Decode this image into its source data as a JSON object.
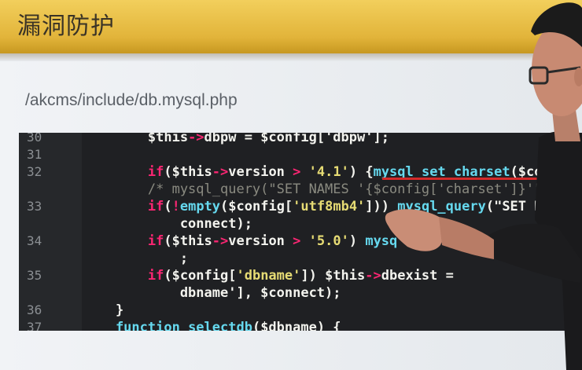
{
  "slide": {
    "title": "漏洞防护",
    "path": "/akcms/include/db.mysql.php"
  },
  "code": {
    "lines": [
      {
        "num": "30",
        "parts": [
          {
            "t": "        $this",
            "c": "pl"
          },
          {
            "t": "->",
            "c": "kw"
          },
          {
            "t": "dbpw = $config['dbpw'];",
            "c": "pl"
          }
        ]
      },
      {
        "num": "31",
        "parts": []
      },
      {
        "num": "32",
        "parts": [
          {
            "t": "        if",
            "c": "kw"
          },
          {
            "t": "($this",
            "c": "pl"
          },
          {
            "t": "->",
            "c": "kw"
          },
          {
            "t": "version ",
            "c": "pl"
          },
          {
            "t": ">",
            "c": "kw"
          },
          {
            "t": " ",
            "c": "pl"
          },
          {
            "t": "'4.1'",
            "c": "str"
          },
          {
            "t": ") {",
            "c": "pl"
          },
          {
            "t": "mysql_set_charset",
            "c": "fn"
          },
          {
            "t": "($confi",
            "c": "pl"
          }
        ]
      },
      {
        "num": "",
        "parts": [
          {
            "t": "        /* mysql_query(\"SET NAMES '{$config['charset']}'\", ",
            "c": "cmt"
          }
        ]
      },
      {
        "num": "33",
        "parts": [
          {
            "t": "        if",
            "c": "kw"
          },
          {
            "t": "(",
            "c": "pl"
          },
          {
            "t": "!",
            "c": "kw"
          },
          {
            "t": "empty",
            "c": "fn"
          },
          {
            "t": "($config[",
            "c": "pl"
          },
          {
            "t": "'utf8mb4'",
            "c": "str"
          },
          {
            "t": "])) ",
            "c": "pl"
          },
          {
            "t": "mysql_query",
            "c": "fn"
          },
          {
            "t": "(\"SET NAM",
            "c": "pl"
          }
        ]
      },
      {
        "num": "",
        "parts": [
          {
            "t": "            connect);",
            "c": "pl"
          }
        ]
      },
      {
        "num": "34",
        "parts": [
          {
            "t": "        if",
            "c": "kw"
          },
          {
            "t": "($this",
            "c": "pl"
          },
          {
            "t": "->",
            "c": "kw"
          },
          {
            "t": "version ",
            "c": "pl"
          },
          {
            "t": ">",
            "c": "kw"
          },
          {
            "t": " ",
            "c": "pl"
          },
          {
            "t": "'5.0'",
            "c": "str"
          },
          {
            "t": ") ",
            "c": "pl"
          },
          {
            "t": "mysq",
            "c": "fn"
          }
        ]
      },
      {
        "num": "",
        "parts": [
          {
            "t": "            ;",
            "c": "pl"
          }
        ]
      },
      {
        "num": "35",
        "parts": [
          {
            "t": "        if",
            "c": "kw"
          },
          {
            "t": "($config[",
            "c": "pl"
          },
          {
            "t": "'dbname'",
            "c": "str"
          },
          {
            "t": "]) $this",
            "c": "pl"
          },
          {
            "t": "->",
            "c": "kw"
          },
          {
            "t": "dbexist = ",
            "c": "pl"
          }
        ]
      },
      {
        "num": "",
        "parts": [
          {
            "t": "            dbname'], $connect);",
            "c": "pl"
          }
        ]
      },
      {
        "num": "36",
        "parts": [
          {
            "t": "    }",
            "c": "pl"
          }
        ]
      },
      {
        "num": "37",
        "parts": [
          {
            "t": "    function ",
            "c": "fn"
          },
          {
            "t": "selectdb",
            "c": "fn"
          },
          {
            "t": "($dbname) {",
            "c": "pl"
          }
        ]
      }
    ]
  },
  "colors": {
    "header": "#e2b43a",
    "code_bg": "#1f2023",
    "keyword": "#f92672",
    "function": "#66d9ef",
    "string": "#e6db74",
    "underline": "#d42a2a"
  }
}
